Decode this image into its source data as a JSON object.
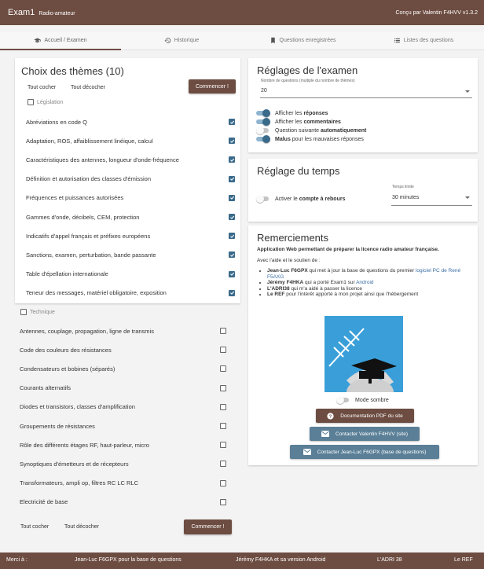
{
  "app": {
    "title": "Exam1",
    "subtitle": "Radio-amateur",
    "credit": "Conçu par Valentin F4HVV   v1.3.2"
  },
  "tabs": [
    {
      "label": "Accueil / Examen",
      "icon": "graduation-cap-icon"
    },
    {
      "label": "Historique",
      "icon": "history-icon"
    },
    {
      "label": "Questions enregistrées",
      "icon": "bookmark-icon"
    },
    {
      "label": "Listes des questions",
      "icon": "list-icon"
    }
  ],
  "themes": {
    "title": "Choix des thèmes (10)",
    "check_all": "Tout cocher",
    "uncheck_all": "Tout décocher",
    "start": "Commencer !",
    "legislation": {
      "label": "Législation",
      "items": [
        "Abréviations en code Q",
        "Adaptation, ROS, affaiblissement linéique, calcul",
        "Caractéristiques des antennes, longueur d'onde-fréquence",
        "Définition et autorisation des classes d'émission",
        "Fréquences et puissances autorisées",
        "Gammes d'onde, décibels, CEM, protection",
        "Indicatifs d'appel français et préfixes européens",
        "Sanctions, examen, perturbation, bande passante",
        "Table d'épellation internationale",
        "Teneur des messages, matériel obligatoire, exposition"
      ]
    },
    "technique": {
      "label": "Technique",
      "items": [
        "Antennes, couplage, propagation, ligne de transmis",
        "Code des couleurs des résistances",
        "Condensateurs et bobines (séparés)",
        "Courants alternatifs",
        "Diodes et transistors, classes d'amplification",
        "Groupements de résistances",
        "Rôle des différents étages RF, haut-parleur, micro",
        "Synoptiques d'émetteurs et de récepteurs",
        "Transformateurs, ampli op, filtres RC LC RLC",
        "Electricité de base"
      ]
    }
  },
  "settings": {
    "title": "Réglages de l'examen",
    "count_label": "Nombre de questions (multiple du nombre de thèmes)",
    "count_value": "20",
    "toggles": [
      {
        "prefix": "Afficher les ",
        "bold": "réponses",
        "suffix": "",
        "on": true
      },
      {
        "prefix": "Afficher les ",
        "bold": "commentaires",
        "suffix": "",
        "on": true
      },
      {
        "prefix": "Question suivante ",
        "bold": "automatiquement",
        "suffix": "",
        "on": false
      },
      {
        "prefix": "",
        "bold": "Malus",
        "suffix": " pour les mauvaises réponses",
        "on": true
      }
    ]
  },
  "time": {
    "title": "Réglage du temps",
    "toggle_prefix": "Activer le ",
    "toggle_bold": "compte à rebours",
    "limit_label": "Temps limite",
    "limit_value": "30 minutes"
  },
  "thanks": {
    "title": "Remerciements",
    "subtitle": "Application Web permettant de préparer la licence radio amateur française.",
    "intro": "Avec l'aide et le soutien de :",
    "people": [
      {
        "name": "Jean-Luc F6GPX",
        "text": " qui met à jour la base de questions du premier ",
        "link": "logiciel PC de René F5AXG"
      },
      {
        "name": "Jérémy F4HKA",
        "text": " qui a porté Exam1 sur ",
        "link": "Android"
      },
      {
        "name": "L'ADRI38",
        "text": " qui m'a aidé à passer la licence",
        "link": ""
      },
      {
        "name": "Le REF",
        "text": " pour l'intérêt apporté à mon projet ainsi que l'hébergement",
        "link": ""
      }
    ],
    "dark_mode": "Mode sombre",
    "pdf_button": "Documentation PDF du site",
    "contact_valentin": "Contacter Valentin F4HVV (site)",
    "contact_jeanluc": "Contacter Jean-Luc F6GPX (base de questions)"
  },
  "footer": {
    "merci": "Merci à :",
    "items": [
      "Jean-Luc F6GPX pour la base de questions",
      "Jérémy F4HKA et sa version Android",
      "L'ADRI 38",
      "Le REF"
    ]
  },
  "colors": {
    "brand": "#6d4c41",
    "accent": "#3a6a8a",
    "button_blue": "#5a7f97",
    "logo_blue": "#3a9fd9"
  }
}
